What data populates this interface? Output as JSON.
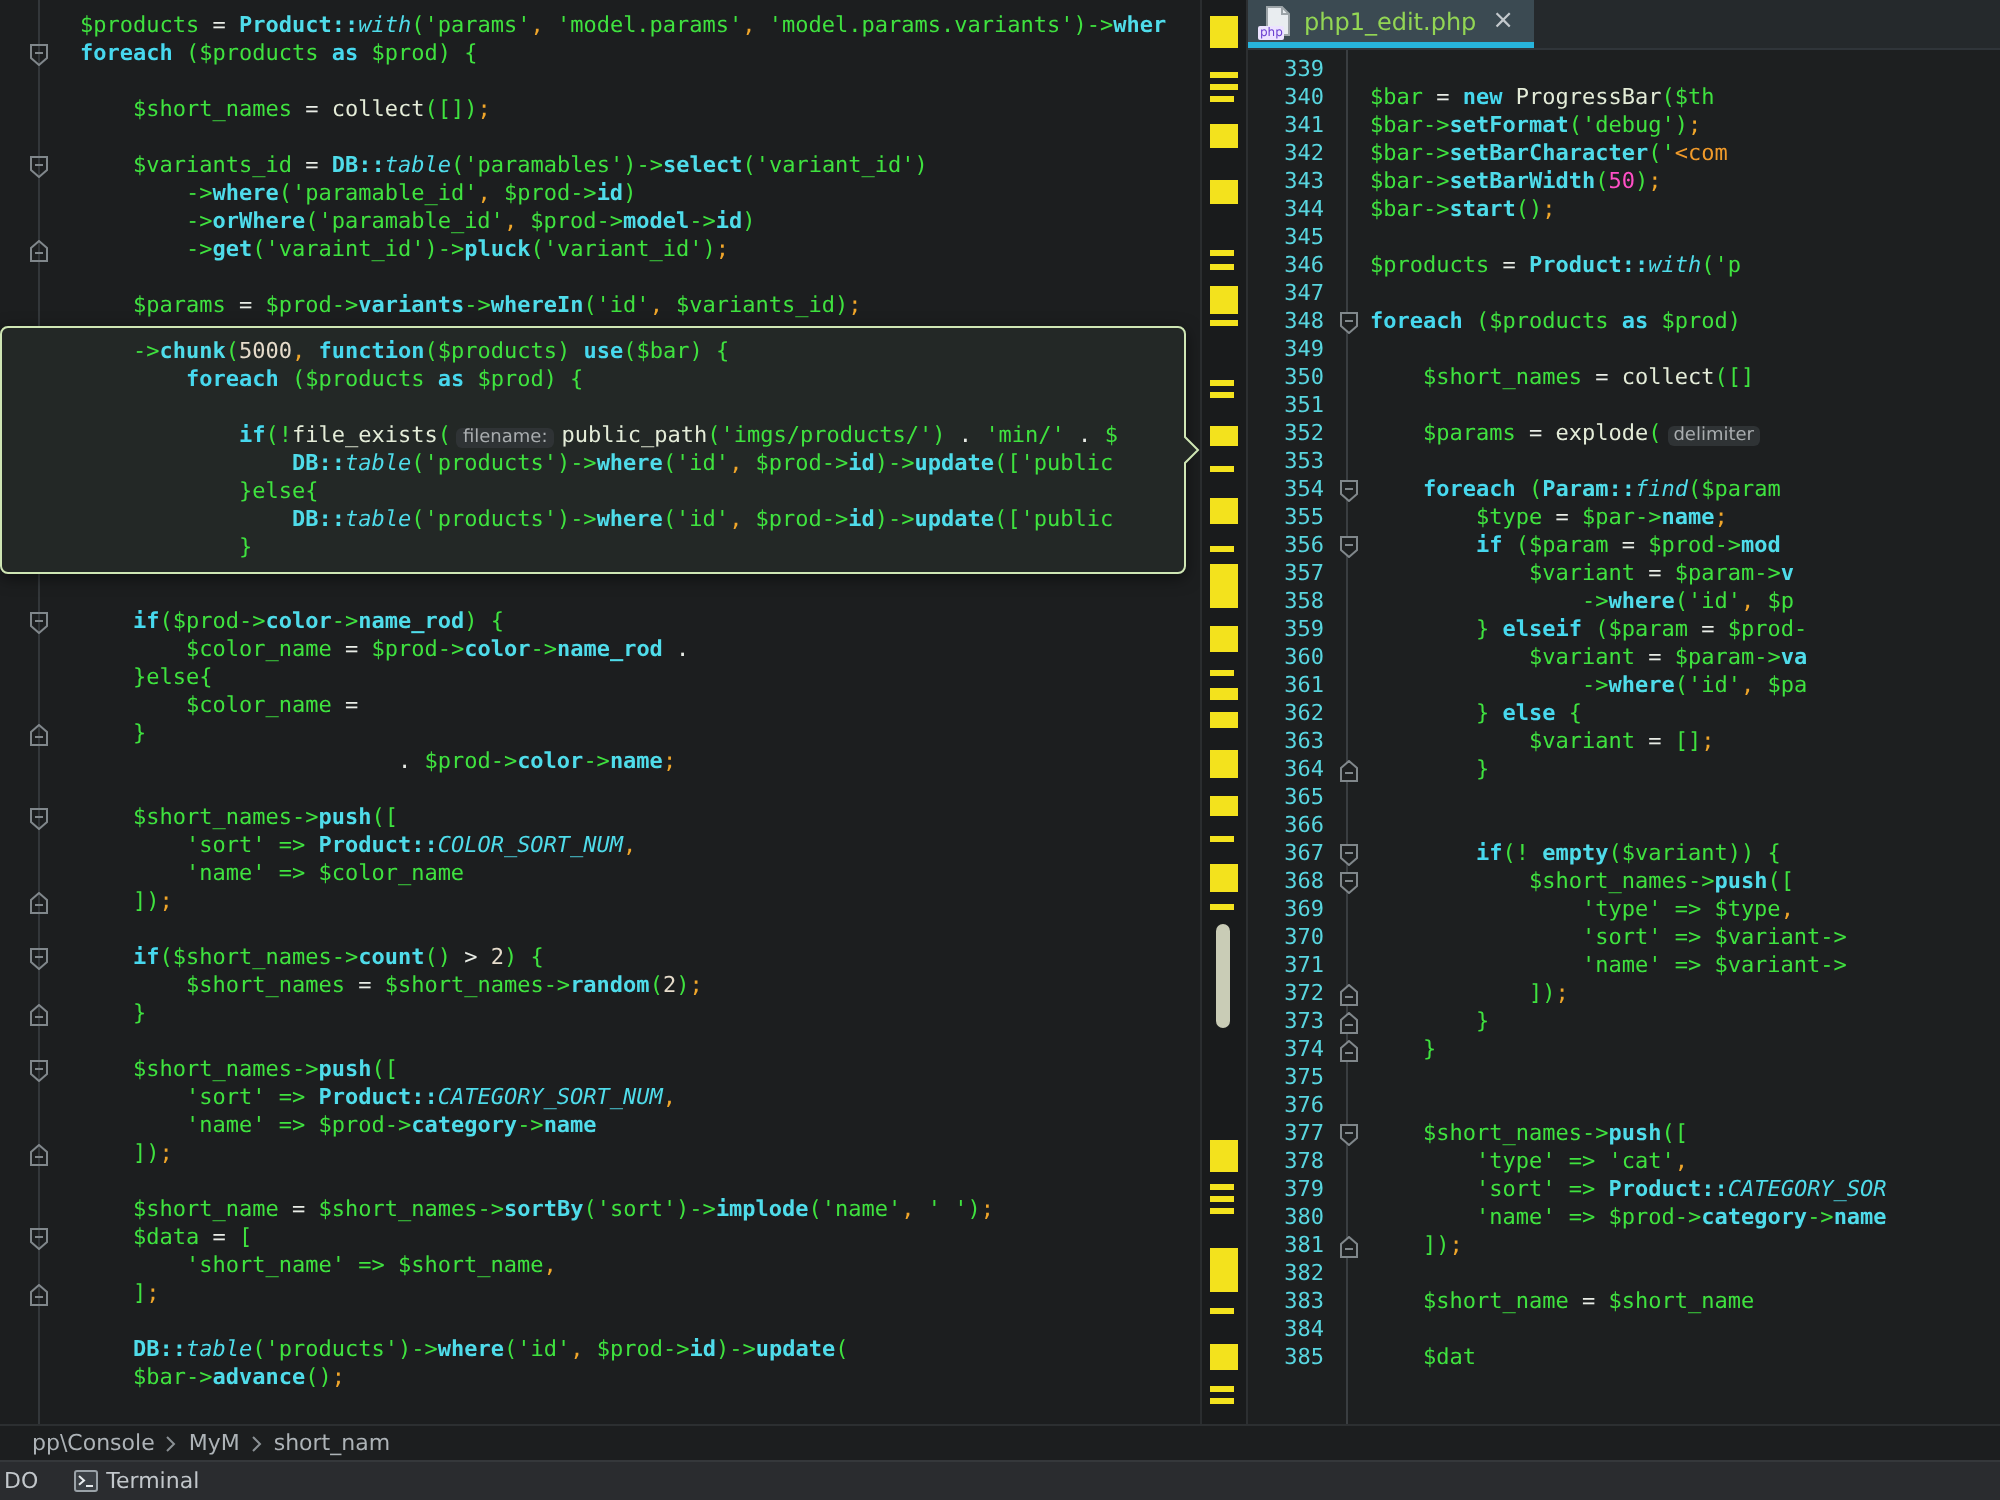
{
  "left_editor": {
    "lines": [
      {
        "kind": "code",
        "tokens": [
          {
            "text": "$products",
            "kind": "plain"
          },
          {
            "text": " = ",
            "kind": "operator"
          },
          {
            "text": "Product::",
            "kind": "member"
          },
          {
            "text": "with",
            "kind": "static"
          },
          {
            "text": "('params'",
            "kind": "plain"
          },
          {
            "text": ",",
            "kind": "punct_end"
          },
          {
            "text": " 'model.params'",
            "kind": "plain"
          },
          {
            "text": ",",
            "kind": "punct_end"
          },
          {
            "text": " 'model.params.variants')->",
            "kind": "plain"
          },
          {
            "text": "wher",
            "kind": "member"
          }
        ]
      },
      {
        "kind": "code",
        "fold": {
          "kind": "start"
        },
        "tokens": [
          {
            "text": "foreach",
            "kind": "keyword"
          },
          {
            "text": " ($products ",
            "kind": "plain"
          },
          {
            "text": "as",
            "kind": "keyword"
          },
          {
            "text": " $prod) {",
            "kind": "plain"
          }
        ]
      },
      {
        "kind": "blank"
      },
      {
        "kind": "code",
        "tokens": [
          {
            "text": "    $short_names",
            "kind": "plain"
          },
          {
            "text": " = ",
            "kind": "operator"
          },
          {
            "text": "collect",
            "kind": "builtin"
          },
          {
            "text": "([])",
            "kind": "plain"
          },
          {
            "text": ";",
            "kind": "punct_end"
          }
        ]
      },
      {
        "kind": "blank"
      },
      {
        "kind": "code",
        "fold": {
          "kind": "start"
        },
        "tokens": [
          {
            "text": "    $variants_id",
            "kind": "plain"
          },
          {
            "text": " = ",
            "kind": "operator"
          },
          {
            "text": "DB::",
            "kind": "member"
          },
          {
            "text": "table",
            "kind": "static"
          },
          {
            "text": "('paramables')->",
            "kind": "plain"
          },
          {
            "text": "select",
            "kind": "member"
          },
          {
            "text": "('variant_id')",
            "kind": "plain"
          }
        ]
      },
      {
        "kind": "code",
        "tokens": [
          {
            "text": "        ->",
            "kind": "plain"
          },
          {
            "text": "where",
            "kind": "member"
          },
          {
            "text": "('paramable_id'",
            "kind": "plain"
          },
          {
            "text": ",",
            "kind": "punct_end"
          },
          {
            "text": " $prod->",
            "kind": "plain"
          },
          {
            "text": "id",
            "kind": "member"
          },
          {
            "text": ")",
            "kind": "plain"
          }
        ]
      },
      {
        "kind": "code",
        "tokens": [
          {
            "text": "        ->",
            "kind": "plain"
          },
          {
            "text": "orWhere",
            "kind": "member"
          },
          {
            "text": "('paramable_id'",
            "kind": "plain"
          },
          {
            "text": ",",
            "kind": "punct_end"
          },
          {
            "text": " $prod->",
            "kind": "plain"
          },
          {
            "text": "model",
            "kind": "member"
          },
          {
            "text": "->",
            "kind": "plain"
          },
          {
            "text": "id",
            "kind": "member"
          },
          {
            "text": ")",
            "kind": "plain"
          }
        ]
      },
      {
        "kind": "code",
        "fold": {
          "kind": "end"
        },
        "tokens": [
          {
            "text": "        ->",
            "kind": "plain"
          },
          {
            "text": "get",
            "kind": "member"
          },
          {
            "text": "('varaint_id')->",
            "kind": "plain"
          },
          {
            "text": "pluck",
            "kind": "member"
          },
          {
            "text": "('variant_id')",
            "kind": "plain"
          },
          {
            "text": ";",
            "kind": "punct_end"
          }
        ]
      },
      {
        "kind": "blank"
      },
      {
        "kind": "code",
        "tokens": [
          {
            "text": "    $params",
            "kind": "plain"
          },
          {
            "text": " = ",
            "kind": "operator"
          },
          {
            "text": "$prod->",
            "kind": "plain"
          },
          {
            "text": "variants",
            "kind": "member"
          },
          {
            "text": "->",
            "kind": "plain"
          },
          {
            "text": "whereIn",
            "kind": "member"
          },
          {
            "text": "('id'",
            "kind": "plain"
          },
          {
            "text": ",",
            "kind": "punct_end"
          },
          {
            "text": " $variants_id)",
            "kind": "plain"
          },
          {
            "text": ";",
            "kind": "punct_end"
          }
        ]
      },
      {
        "kind": "popup",
        "lines": [
          {
            "kind": "code",
            "tokens": [
              {
                "text": "    ->",
                "kind": "plain"
              },
              {
                "text": "chunk",
                "kind": "member"
              },
              {
                "text": "(",
                "kind": "plain"
              },
              {
                "text": "5000",
                "kind": "number"
              },
              {
                "text": ",",
                "kind": "punct_end"
              },
              {
                "text": " function",
                "kind": "keyword"
              },
              {
                "text": "($products) ",
                "kind": "plain"
              },
              {
                "text": "use",
                "kind": "keyword"
              },
              {
                "text": "($bar) {",
                "kind": "plain"
              }
            ]
          },
          {
            "kind": "code",
            "tokens": [
              {
                "text": "        foreach",
                "kind": "keyword"
              },
              {
                "text": " ($products ",
                "kind": "plain"
              },
              {
                "text": "as",
                "kind": "keyword"
              },
              {
                "text": " $prod) {",
                "kind": "plain"
              }
            ]
          },
          {
            "kind": "blank"
          },
          {
            "kind": "code",
            "tokens": [
              {
                "text": "            if",
                "kind": "keyword"
              },
              {
                "text": "(!",
                "kind": "plain"
              },
              {
                "text": "file_exists",
                "kind": "builtin"
              },
              {
                "text": "(",
                "kind": "plain"
              },
              {
                "text": "filename:",
                "kind": "hint"
              },
              {
                "text": "public_path",
                "kind": "builtin"
              },
              {
                "text": "('imgs/products/')",
                "kind": "plain"
              },
              {
                "text": " . ",
                "kind": "operator"
              },
              {
                "text": "'min/'",
                "kind": "plain"
              },
              {
                "text": " . ",
                "kind": "operator"
              },
              {
                "text": "$",
                "kind": "plain"
              }
            ]
          },
          {
            "kind": "code",
            "tokens": [
              {
                "text": "                DB::",
                "kind": "member"
              },
              {
                "text": "table",
                "kind": "static"
              },
              {
                "text": "('products')->",
                "kind": "plain"
              },
              {
                "text": "where",
                "kind": "member"
              },
              {
                "text": "('id'",
                "kind": "plain"
              },
              {
                "text": ",",
                "kind": "punct_end"
              },
              {
                "text": " $prod->",
                "kind": "plain"
              },
              {
                "text": "id",
                "kind": "member"
              },
              {
                "text": ")->",
                "kind": "plain"
              },
              {
                "text": "update",
                "kind": "member"
              },
              {
                "text": "(['public",
                "kind": "plain"
              }
            ]
          },
          {
            "kind": "code",
            "tokens": [
              {
                "text": "            }else{",
                "kind": "plain"
              }
            ]
          },
          {
            "kind": "code",
            "tokens": [
              {
                "text": "                DB::",
                "kind": "member"
              },
              {
                "text": "table",
                "kind": "static"
              },
              {
                "text": "('products')->",
                "kind": "plain"
              },
              {
                "text": "where",
                "kind": "member"
              },
              {
                "text": "('id'",
                "kind": "plain"
              },
              {
                "text": ",",
                "kind": "punct_end"
              },
              {
                "text": " $prod->",
                "kind": "plain"
              },
              {
                "text": "id",
                "kind": "member"
              },
              {
                "text": ")->",
                "kind": "plain"
              },
              {
                "text": "update",
                "kind": "member"
              },
              {
                "text": "(['public",
                "kind": "plain"
              }
            ]
          },
          {
            "kind": "code",
            "tokens": [
              {
                "text": "            }",
                "kind": "plain"
              }
            ]
          }
        ]
      },
      {
        "kind": "blank"
      },
      {
        "kind": "code",
        "fold": {
          "kind": "start"
        },
        "tokens": [
          {
            "text": "    if",
            "kind": "keyword"
          },
          {
            "text": "($prod->",
            "kind": "plain"
          },
          {
            "text": "color",
            "kind": "member"
          },
          {
            "text": "->",
            "kind": "plain"
          },
          {
            "text": "name_rod",
            "kind": "member"
          },
          {
            "text": ") {",
            "kind": "plain"
          }
        ]
      },
      {
        "kind": "code",
        "tokens": [
          {
            "text": "        $color_name",
            "kind": "plain"
          },
          {
            "text": " = ",
            "kind": "operator"
          },
          {
            "text": "$prod->",
            "kind": "plain"
          },
          {
            "text": "color",
            "kind": "member"
          },
          {
            "text": "->",
            "kind": "plain"
          },
          {
            "text": "name_rod",
            "kind": "member"
          },
          {
            "text": " .",
            "kind": "operator"
          }
        ]
      },
      {
        "kind": "code",
        "tokens": [
          {
            "text": "    }else{",
            "kind": "plain"
          }
        ]
      },
      {
        "kind": "code",
        "tokens": [
          {
            "text": "        $color_name",
            "kind": "plain"
          },
          {
            "text": " =",
            "kind": "operator"
          }
        ]
      },
      {
        "kind": "code",
        "fold": {
          "kind": "end"
        },
        "tokens": [
          {
            "text": "    }",
            "kind": "plain"
          }
        ]
      },
      {
        "kind": "code",
        "tokens": [
          {
            "text": "                        . ",
            "kind": "operator"
          },
          {
            "text": "$prod->",
            "kind": "plain"
          },
          {
            "text": "color",
            "kind": "member"
          },
          {
            "text": "->",
            "kind": "plain"
          },
          {
            "text": "name",
            "kind": "member"
          },
          {
            "text": ";",
            "kind": "punct_end"
          }
        ]
      },
      {
        "kind": "blank"
      },
      {
        "kind": "code",
        "fold": {
          "kind": "start"
        },
        "tokens": [
          {
            "text": "    $short_names->",
            "kind": "plain"
          },
          {
            "text": "push",
            "kind": "member"
          },
          {
            "text": "([",
            "kind": "plain"
          }
        ]
      },
      {
        "kind": "code",
        "tokens": [
          {
            "text": "        'sort' => ",
            "kind": "plain"
          },
          {
            "text": "Product::",
            "kind": "member"
          },
          {
            "text": "COLOR_SORT_NUM",
            "kind": "static"
          },
          {
            "text": ",",
            "kind": "punct_end"
          }
        ]
      },
      {
        "kind": "code",
        "tokens": [
          {
            "text": "        'name' => $color_name",
            "kind": "plain"
          }
        ]
      },
      {
        "kind": "code",
        "fold": {
          "kind": "end"
        },
        "tokens": [
          {
            "text": "    ])",
            "kind": "plain"
          },
          {
            "text": ";",
            "kind": "punct_end"
          }
        ]
      },
      {
        "kind": "blank"
      },
      {
        "kind": "code",
        "fold": {
          "kind": "start"
        },
        "tokens": [
          {
            "text": "    if",
            "kind": "keyword"
          },
          {
            "text": "($short_names->",
            "kind": "plain"
          },
          {
            "text": "count",
            "kind": "member"
          },
          {
            "text": "()",
            "kind": "plain"
          },
          {
            "text": " > ",
            "kind": "operator"
          },
          {
            "text": "2",
            "kind": "number"
          },
          {
            "text": ") {",
            "kind": "plain"
          }
        ]
      },
      {
        "kind": "code",
        "tokens": [
          {
            "text": "        $short_names",
            "kind": "plain"
          },
          {
            "text": " = ",
            "kind": "operator"
          },
          {
            "text": "$short_names->",
            "kind": "plain"
          },
          {
            "text": "random",
            "kind": "member"
          },
          {
            "text": "(",
            "kind": "plain"
          },
          {
            "text": "2",
            "kind": "number"
          },
          {
            "text": ")",
            "kind": "plain"
          },
          {
            "text": ";",
            "kind": "punct_end"
          }
        ]
      },
      {
        "kind": "code",
        "fold": {
          "kind": "end"
        },
        "tokens": [
          {
            "text": "    }",
            "kind": "plain"
          }
        ]
      },
      {
        "kind": "blank"
      },
      {
        "kind": "code",
        "fold": {
          "kind": "start"
        },
        "tokens": [
          {
            "text": "    $short_names->",
            "kind": "plain"
          },
          {
            "text": "push",
            "kind": "member"
          },
          {
            "text": "([",
            "kind": "plain"
          }
        ]
      },
      {
        "kind": "code",
        "tokens": [
          {
            "text": "        'sort' => ",
            "kind": "plain"
          },
          {
            "text": "Product::",
            "kind": "member"
          },
          {
            "text": "CATEGORY_SORT_NUM",
            "kind": "static"
          },
          {
            "text": ",",
            "kind": "punct_end"
          }
        ]
      },
      {
        "kind": "code",
        "tokens": [
          {
            "text": "        'name' => $prod->",
            "kind": "plain"
          },
          {
            "text": "category",
            "kind": "member"
          },
          {
            "text": "->",
            "kind": "plain"
          },
          {
            "text": "name",
            "kind": "member"
          }
        ]
      },
      {
        "kind": "code",
        "fold": {
          "kind": "end"
        },
        "tokens": [
          {
            "text": "    ])",
            "kind": "plain"
          },
          {
            "text": ";",
            "kind": "punct_end"
          }
        ]
      },
      {
        "kind": "blank"
      },
      {
        "kind": "code",
        "tokens": [
          {
            "text": "    $short_name",
            "kind": "plain"
          },
          {
            "text": " = ",
            "kind": "operator"
          },
          {
            "text": "$short_names->",
            "kind": "plain"
          },
          {
            "text": "sortBy",
            "kind": "member"
          },
          {
            "text": "('sort')->",
            "kind": "plain"
          },
          {
            "text": "implode",
            "kind": "member"
          },
          {
            "text": "('name'",
            "kind": "plain"
          },
          {
            "text": ",",
            "kind": "punct_end"
          },
          {
            "text": " ' ')",
            "kind": "plain"
          },
          {
            "text": ";",
            "kind": "punct_end"
          }
        ]
      },
      {
        "kind": "code",
        "fold": {
          "kind": "start"
        },
        "tokens": [
          {
            "text": "    $data",
            "kind": "plain"
          },
          {
            "text": " = ",
            "kind": "operator"
          },
          {
            "text": "[",
            "kind": "plain"
          }
        ]
      },
      {
        "kind": "code",
        "tokens": [
          {
            "text": "        'short_name' => $short_name",
            "kind": "plain"
          },
          {
            "text": ",",
            "kind": "punct_end"
          }
        ]
      },
      {
        "kind": "code",
        "fold": {
          "kind": "end"
        },
        "tokens": [
          {
            "text": "    ]",
            "kind": "plain"
          },
          {
            "text": ";",
            "kind": "punct_end"
          }
        ]
      },
      {
        "kind": "blank"
      },
      {
        "kind": "code",
        "tokens": [
          {
            "text": "    DB::",
            "kind": "member"
          },
          {
            "text": "table",
            "kind": "static"
          },
          {
            "text": "('products')->",
            "kind": "plain"
          },
          {
            "text": "where",
            "kind": "member"
          },
          {
            "text": "('id'",
            "kind": "plain"
          },
          {
            "text": ",",
            "kind": "punct_end"
          },
          {
            "text": " $prod->",
            "kind": "plain"
          },
          {
            "text": "id",
            "kind": "member"
          },
          {
            "text": ")->",
            "kind": "plain"
          },
          {
            "text": "update",
            "kind": "member"
          },
          {
            "text": "(",
            "kind": "plain"
          }
        ]
      },
      {
        "kind": "code",
        "tokens": [
          {
            "text": "    $bar->",
            "kind": "plain"
          },
          {
            "text": "advance",
            "kind": "member"
          },
          {
            "text": "()",
            "kind": "plain"
          },
          {
            "text": ";",
            "kind": "punct_end"
          }
        ]
      }
    ]
  },
  "right_editor": {
    "tabs": [
      {
        "label": "php1_edit.php",
        "icon_label": "php",
        "close": "×",
        "selected": true
      }
    ],
    "lines": [
      {
        "number": "339"
      },
      {
        "number": "340",
        "tokens": [
          {
            "text": "$bar",
            "kind": "plain"
          },
          {
            "text": " = ",
            "kind": "operator"
          },
          {
            "text": "new",
            "kind": "keyword"
          },
          {
            "text": " ProgressBar",
            "kind": "builtin"
          },
          {
            "text": "($th",
            "kind": "plain"
          }
        ]
      },
      {
        "number": "341",
        "tokens": [
          {
            "text": "$bar->",
            "kind": "plain"
          },
          {
            "text": "setFormat",
            "kind": "member"
          },
          {
            "text": "('debug')",
            "kind": "plain"
          },
          {
            "text": ";",
            "kind": "punct_end"
          }
        ]
      },
      {
        "number": "342",
        "tokens": [
          {
            "text": "$bar->",
            "kind": "plain"
          },
          {
            "text": "setBarCharacter",
            "kind": "member"
          },
          {
            "text": "('",
            "kind": "plain"
          },
          {
            "text": "<com",
            "kind": "markup"
          }
        ]
      },
      {
        "number": "343",
        "tokens": [
          {
            "text": "$bar->",
            "kind": "plain"
          },
          {
            "text": "setBarWidth",
            "kind": "member"
          },
          {
            "text": "(",
            "kind": "plain"
          },
          {
            "text": "50",
            "kind": "literal"
          },
          {
            "text": ")",
            "kind": "plain"
          },
          {
            "text": ";",
            "kind": "punct_end"
          }
        ]
      },
      {
        "number": "344",
        "tokens": [
          {
            "text": "$bar->",
            "kind": "plain"
          },
          {
            "text": "start",
            "kind": "member"
          },
          {
            "text": "()",
            "kind": "plain"
          },
          {
            "text": ";",
            "kind": "punct_end"
          }
        ]
      },
      {
        "number": "345"
      },
      {
        "number": "346",
        "tokens": [
          {
            "text": "$products",
            "kind": "plain"
          },
          {
            "text": " = ",
            "kind": "operator"
          },
          {
            "text": "Product::",
            "kind": "member"
          },
          {
            "text": "with",
            "kind": "static"
          },
          {
            "text": "('p",
            "kind": "plain"
          }
        ]
      },
      {
        "number": "347"
      },
      {
        "number": "348",
        "fold": {
          "kind": "start"
        },
        "tokens": [
          {
            "text": "foreach",
            "kind": "keyword"
          },
          {
            "text": " ($products ",
            "kind": "plain"
          },
          {
            "text": "as",
            "kind": "keyword"
          },
          {
            "text": " $prod)",
            "kind": "plain"
          }
        ]
      },
      {
        "number": "349"
      },
      {
        "number": "350",
        "tokens": [
          {
            "text": "    $short_names",
            "kind": "plain"
          },
          {
            "text": " = ",
            "kind": "operator"
          },
          {
            "text": "collect",
            "kind": "builtin"
          },
          {
            "text": "([]",
            "kind": "plain"
          }
        ]
      },
      {
        "number": "351"
      },
      {
        "number": "352",
        "tokens": [
          {
            "text": "    $params",
            "kind": "plain"
          },
          {
            "text": " = ",
            "kind": "operator"
          },
          {
            "text": "explode",
            "kind": "builtin"
          },
          {
            "text": "(",
            "kind": "plain"
          },
          {
            "text": "delimiter",
            "kind": "hint"
          }
        ]
      },
      {
        "number": "353"
      },
      {
        "number": "354",
        "fold": {
          "kind": "start"
        },
        "tokens": [
          {
            "text": "    foreach",
            "kind": "keyword"
          },
          {
            "text": " (",
            "kind": "plain"
          },
          {
            "text": "Param::",
            "kind": "member"
          },
          {
            "text": "find",
            "kind": "static"
          },
          {
            "text": "($param",
            "kind": "plain"
          }
        ]
      },
      {
        "number": "355",
        "tokens": [
          {
            "text": "        $type",
            "kind": "plain"
          },
          {
            "text": " = ",
            "kind": "operator"
          },
          {
            "text": "$par->",
            "kind": "plain"
          },
          {
            "text": "name",
            "kind": "member"
          },
          {
            "text": ";",
            "kind": "punct_end"
          }
        ]
      },
      {
        "number": "356",
        "fold": {
          "kind": "start"
        },
        "tokens": [
          {
            "text": "        if",
            "kind": "keyword"
          },
          {
            "text": " ($param",
            "kind": "plain"
          },
          {
            "text": " = ",
            "kind": "operator"
          },
          {
            "text": "$prod->",
            "kind": "plain"
          },
          {
            "text": "mod",
            "kind": "member"
          }
        ]
      },
      {
        "number": "357",
        "tokens": [
          {
            "text": "            $variant",
            "kind": "plain"
          },
          {
            "text": " = ",
            "kind": "operator"
          },
          {
            "text": "$param->",
            "kind": "plain"
          },
          {
            "text": "v",
            "kind": "member"
          }
        ]
      },
      {
        "number": "358",
        "tokens": [
          {
            "text": "                ->",
            "kind": "plain"
          },
          {
            "text": "where",
            "kind": "member"
          },
          {
            "text": "('id'",
            "kind": "plain"
          },
          {
            "text": ",",
            "kind": "punct_end"
          },
          {
            "text": " $p",
            "kind": "plain"
          }
        ]
      },
      {
        "number": "359",
        "tokens": [
          {
            "text": "        } ",
            "kind": "plain"
          },
          {
            "text": "elseif",
            "kind": "keyword"
          },
          {
            "text": " ($param",
            "kind": "plain"
          },
          {
            "text": " = ",
            "kind": "operator"
          },
          {
            "text": "$prod-",
            "kind": "plain"
          }
        ]
      },
      {
        "number": "360",
        "tokens": [
          {
            "text": "            $variant",
            "kind": "plain"
          },
          {
            "text": " = ",
            "kind": "operator"
          },
          {
            "text": "$param->",
            "kind": "plain"
          },
          {
            "text": "va",
            "kind": "member"
          }
        ]
      },
      {
        "number": "361",
        "tokens": [
          {
            "text": "                ->",
            "kind": "plain"
          },
          {
            "text": "where",
            "kind": "member"
          },
          {
            "text": "('id'",
            "kind": "plain"
          },
          {
            "text": ",",
            "kind": "punct_end"
          },
          {
            "text": " $pa",
            "kind": "plain"
          }
        ]
      },
      {
        "number": "362",
        "tokens": [
          {
            "text": "        } ",
            "kind": "plain"
          },
          {
            "text": "else",
            "kind": "keyword"
          },
          {
            "text": " {",
            "kind": "plain"
          }
        ]
      },
      {
        "number": "363",
        "tokens": [
          {
            "text": "            $variant",
            "kind": "plain"
          },
          {
            "text": " = ",
            "kind": "operator"
          },
          {
            "text": "[]",
            "kind": "plain"
          },
          {
            "text": ";",
            "kind": "punct_end"
          }
        ]
      },
      {
        "number": "364",
        "fold": {
          "kind": "end"
        },
        "tokens": [
          {
            "text": "        }",
            "kind": "plain"
          }
        ]
      },
      {
        "number": "365"
      },
      {
        "number": "366"
      },
      {
        "number": "367",
        "fold": {
          "kind": "start"
        },
        "tokens": [
          {
            "text": "        if",
            "kind": "keyword"
          },
          {
            "text": "(! ",
            "kind": "plain"
          },
          {
            "text": "empty",
            "kind": "member"
          },
          {
            "text": "($variant)) {",
            "kind": "plain"
          }
        ]
      },
      {
        "number": "368",
        "fold": {
          "kind": "start"
        },
        "tokens": [
          {
            "text": "            $short_names->",
            "kind": "plain"
          },
          {
            "text": "push",
            "kind": "member"
          },
          {
            "text": "([",
            "kind": "plain"
          }
        ]
      },
      {
        "number": "369",
        "tokens": [
          {
            "text": "                'type' => $type",
            "kind": "plain"
          },
          {
            "text": ",",
            "kind": "punct_end"
          }
        ]
      },
      {
        "number": "370",
        "tokens": [
          {
            "text": "                'sort' => $variant->",
            "kind": "plain"
          }
        ]
      },
      {
        "number": "371",
        "tokens": [
          {
            "text": "                'name' => $variant->",
            "kind": "plain"
          }
        ]
      },
      {
        "number": "372",
        "fold": {
          "kind": "end"
        },
        "tokens": [
          {
            "text": "            ])",
            "kind": "plain"
          },
          {
            "text": ";",
            "kind": "punct_end"
          }
        ]
      },
      {
        "number": "373",
        "fold": {
          "kind": "end"
        },
        "tokens": [
          {
            "text": "        }",
            "kind": "plain"
          }
        ]
      },
      {
        "number": "374",
        "fold": {
          "kind": "end"
        },
        "tokens": [
          {
            "text": "    }",
            "kind": "plain"
          }
        ]
      },
      {
        "number": "375"
      },
      {
        "number": "376"
      },
      {
        "number": "377",
        "fold": {
          "kind": "start"
        },
        "tokens": [
          {
            "text": "    $short_names->",
            "kind": "plain"
          },
          {
            "text": "push",
            "kind": "member"
          },
          {
            "text": "([",
            "kind": "plain"
          }
        ]
      },
      {
        "number": "378",
        "tokens": [
          {
            "text": "        'type' => 'cat'",
            "kind": "plain"
          },
          {
            "text": ",",
            "kind": "punct_end"
          }
        ]
      },
      {
        "number": "379",
        "tokens": [
          {
            "text": "        'sort' => ",
            "kind": "plain"
          },
          {
            "text": "Product::",
            "kind": "member"
          },
          {
            "text": "CATEGORY_SOR",
            "kind": "static"
          }
        ]
      },
      {
        "number": "380",
        "tokens": [
          {
            "text": "        'name' => $prod->",
            "kind": "plain"
          },
          {
            "text": "category",
            "kind": "member"
          },
          {
            "text": "->",
            "kind": "plain"
          },
          {
            "text": "name",
            "kind": "member"
          }
        ]
      },
      {
        "number": "381",
        "fold": {
          "kind": "end"
        },
        "tokens": [
          {
            "text": "    ])",
            "kind": "plain"
          },
          {
            "text": ";",
            "kind": "punct_end"
          }
        ]
      },
      {
        "number": "382"
      },
      {
        "number": "383",
        "tokens": [
          {
            "text": "    $short_name",
            "kind": "plain"
          },
          {
            "text": " = ",
            "kind": "operator"
          },
          {
            "text": "$short_name",
            "kind": "plain"
          }
        ]
      },
      {
        "number": "384"
      },
      {
        "number": "385",
        "tokens": [
          {
            "text": "    $dat",
            "kind": "plain"
          }
        ]
      }
    ]
  },
  "breadcrumbs": [
    "pp\\Console",
    "MyM",
    "short_nam"
  ],
  "tool_windows": [
    {
      "label": "DO",
      "has_icon": false
    },
    {
      "label": "Terminal",
      "has_icon": true
    }
  ]
}
